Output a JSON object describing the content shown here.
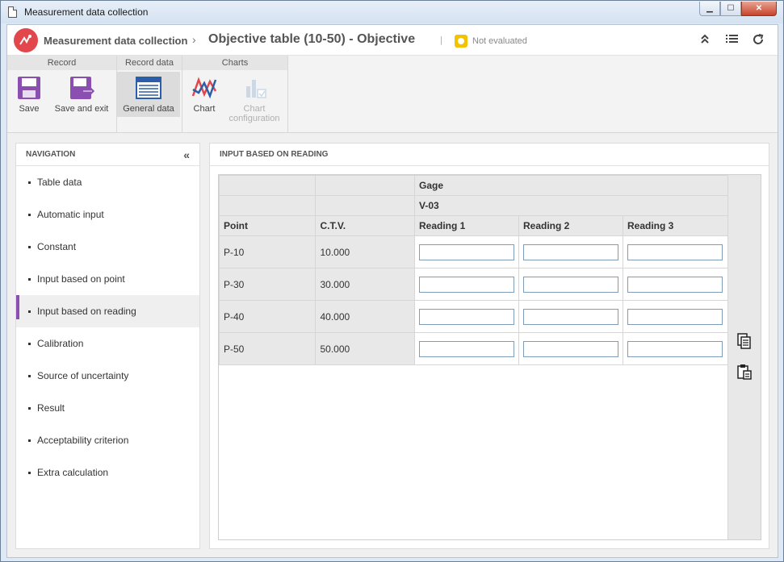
{
  "window": {
    "title": "Measurement data collection",
    "buttons": {
      "minimize": "▁",
      "maximize": "☐",
      "close": "✕"
    }
  },
  "header": {
    "app_name": "Measurement data collection",
    "separator": "›",
    "record_title": "Objective table (10-50) - Objective",
    "divider": "|",
    "status": "Not evaluated",
    "status_color": "#f2c300",
    "icons": [
      "collapse-up-icon",
      "list-icon",
      "refresh-icon"
    ]
  },
  "ribbon": {
    "groups": {
      "record": "Record",
      "record_data": "Record data",
      "charts": "Charts"
    },
    "buttons": {
      "save": "Save",
      "save_exit": "Save and exit",
      "general_data": "General data",
      "chart": "Chart",
      "chart_config": "Chart configuration"
    }
  },
  "nav": {
    "title": "NAVIGATION",
    "collapse": "«",
    "items": [
      "Table data",
      "Automatic input",
      "Constant",
      "Input based on point",
      "Input based on reading",
      "Calibration",
      "Source of uncertainty",
      "Result",
      "Acceptability criterion",
      "Extra calculation"
    ],
    "active_index": 4
  },
  "panel": {
    "title": "INPUT BASED ON READING",
    "table": {
      "gage_label": "Gage",
      "gage_value": "V-03",
      "col_point": "Point",
      "col_ctv": "C.T.V.",
      "readings": [
        "Reading 1",
        "Reading 2",
        "Reading 3"
      ],
      "rows": [
        {
          "point": "P-10",
          "ctv": "10.000"
        },
        {
          "point": "P-30",
          "ctv": "30.000"
        },
        {
          "point": "P-40",
          "ctv": "40.000"
        },
        {
          "point": "P-50",
          "ctv": "50.000"
        }
      ]
    },
    "side_icons": [
      "copy-icon",
      "paste-icon"
    ]
  },
  "colors": {
    "accent": "#8a4fb0",
    "logo": "#e2474b"
  }
}
